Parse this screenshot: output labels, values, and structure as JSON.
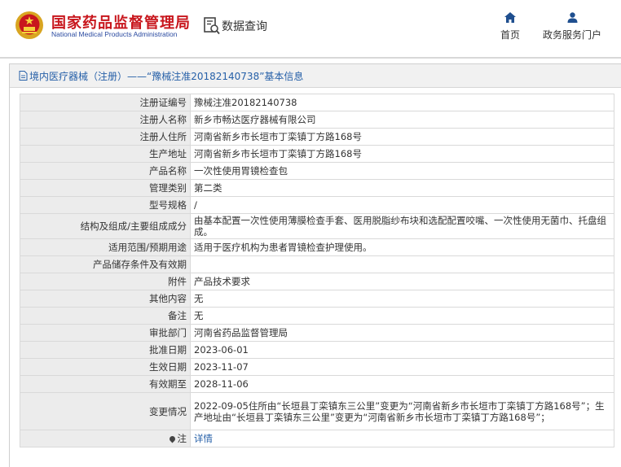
{
  "header": {
    "brand_cn": "国家药品监督管理局",
    "brand_en": "National Medical Products Administration",
    "query_label": "数据查询",
    "nav_home": "首页",
    "nav_service": "政务服务门户"
  },
  "panel": {
    "title": "境内医疗器械（注册）——“豫械注准20182140738”基本信息"
  },
  "rows": [
    {
      "label": "注册证编号",
      "value": "豫械注准20182140738"
    },
    {
      "label": "注册人名称",
      "value": "新乡市畅达医疗器械有限公司"
    },
    {
      "label": "注册人住所",
      "value": "河南省新乡市长垣市丁栾镇丁方路168号"
    },
    {
      "label": "生产地址",
      "value": "河南省新乡市长垣市丁栾镇丁方路168号"
    },
    {
      "label": "产品名称",
      "value": "一次性使用胃镜检查包"
    },
    {
      "label": "管理类别",
      "value": "第二类"
    },
    {
      "label": "型号规格",
      "value": "/"
    },
    {
      "label": "结构及组成/主要组成成分",
      "value": "由基本配置一次性使用薄膜检查手套、医用脱脂纱布块和选配配置咬嘴、一次性使用无菌巾、托盘组成。"
    },
    {
      "label": "适用范围/预期用途",
      "value": "适用于医疗机构为患者胃镜检查护理使用。"
    },
    {
      "label": "产品储存条件及有效期",
      "value": ""
    },
    {
      "label": "附件",
      "value": "产品技术要求"
    },
    {
      "label": "其他内容",
      "value": "无"
    },
    {
      "label": "备注",
      "value": "无"
    },
    {
      "label": "审批部门",
      "value": "河南省药品监督管理局"
    },
    {
      "label": "批准日期",
      "value": "2023-06-01"
    },
    {
      "label": "生效日期",
      "value": "2023-11-07"
    },
    {
      "label": "有效期至",
      "value": "2028-11-06"
    },
    {
      "label": "变更情况",
      "value": "2022-09-05住所由“长垣县丁栾镇东三公里”变更为“河南省新乡市长垣市丁栾镇丁方路168号”；生产地址由“长垣县丁栾镇东三公里”变更为“河南省新乡市长垣市丁栾镇丁方路168号”；"
    },
    {
      "label": "注",
      "value": "详情"
    }
  ],
  "colors": {
    "brand_red": "#c8161d",
    "link_blue": "#2660a8",
    "label_bg": "#ececec"
  },
  "icons": [
    "national-emblem-icon",
    "data-query-icon",
    "home-icon",
    "user-icon",
    "document-icon",
    "pin-icon"
  ]
}
